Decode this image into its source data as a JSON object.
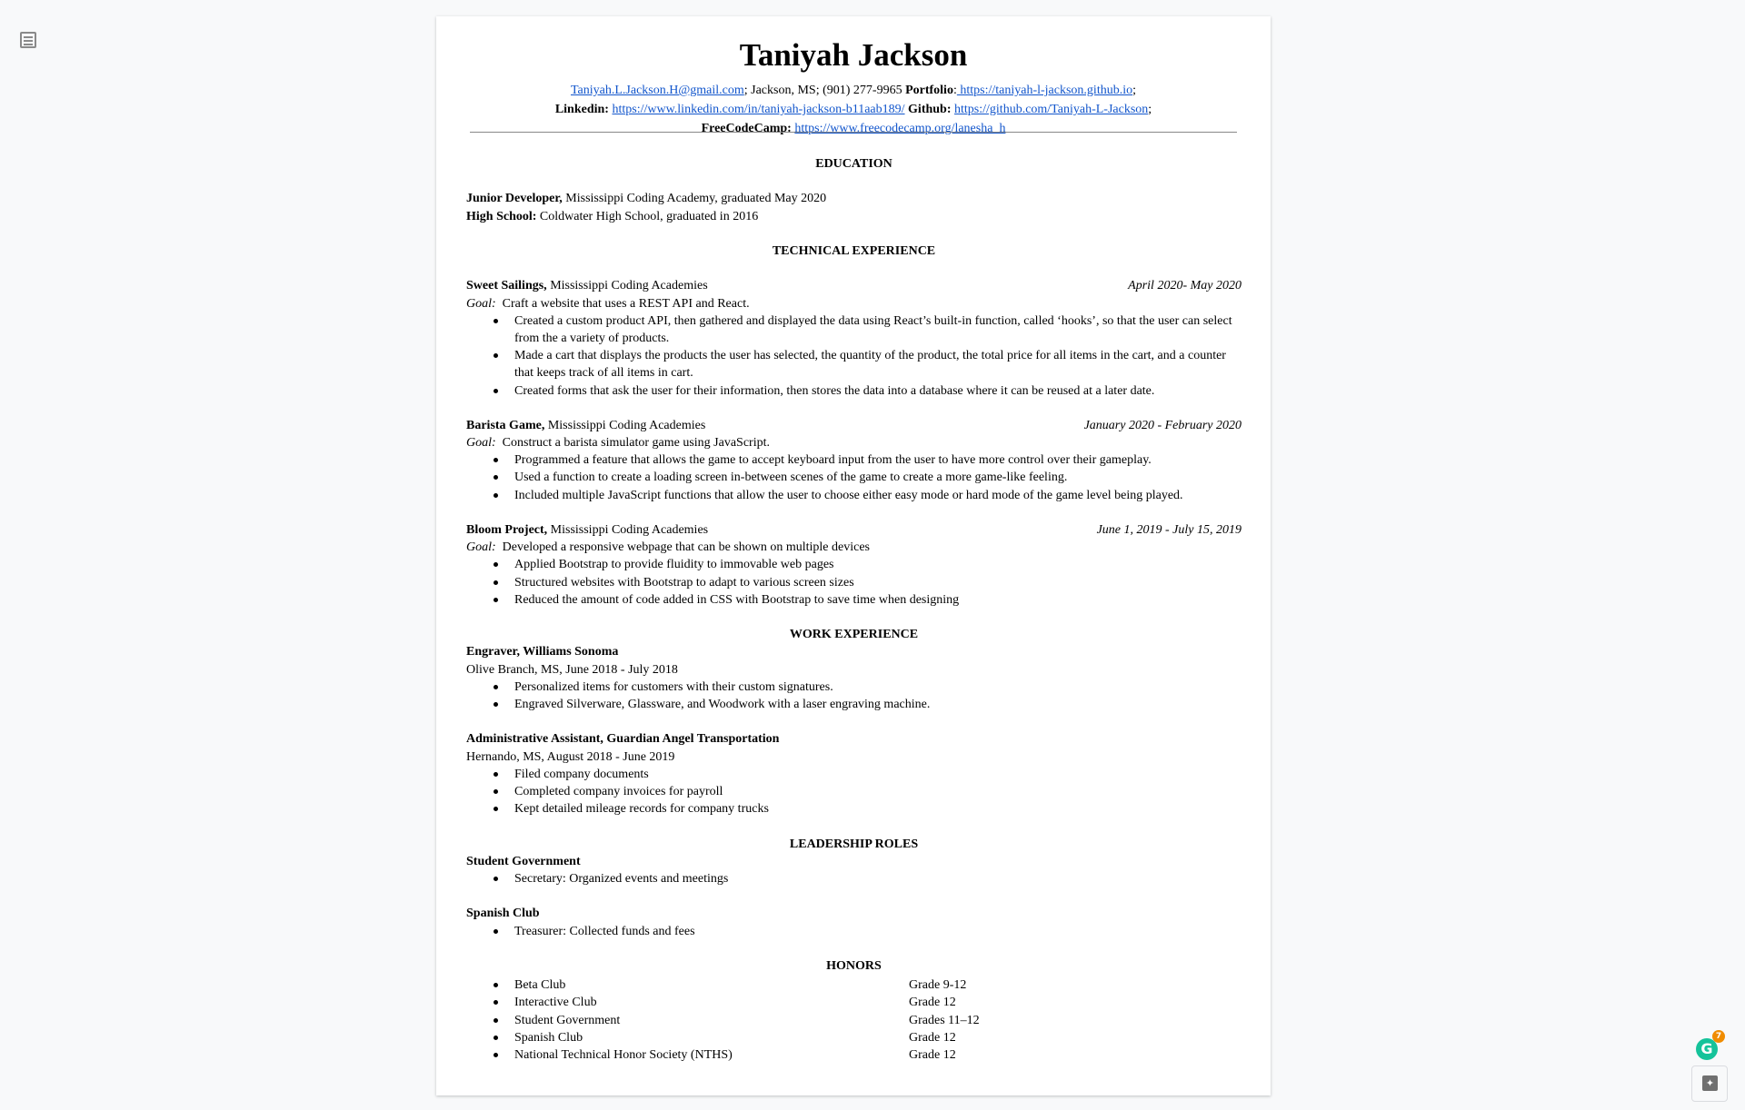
{
  "header": {
    "name": "Taniyah Jackson",
    "email": "Taniyah.L.Jackson.H@gmail.com",
    "location_phone": "; Jackson, MS; (901) 277-9965 ",
    "portfolio_label": "Portfolio",
    "portfolio_url": " https://taniyah-l-jackson.github.io",
    "linkedin_label": "Linkedin:",
    "linkedin_url": "https://www.linkedin.com/in/taniyah-jackson-b11aab189/",
    "github_label": "Github:",
    "github_url": "https://github.com/Taniyah-L-Jackson",
    "fcc_label": "FreeCodeCamp:",
    "fcc_url": "https://www.freecodecamp.org/lanesha_h"
  },
  "education": {
    "heading": "EDUCATION",
    "items": [
      {
        "title": "Junior Developer,",
        "text": " Mississippi Coding Academy, graduated May 2020"
      },
      {
        "title": "High School:",
        "text": " Coldwater High School, graduated in 2016"
      }
    ]
  },
  "technical": {
    "heading": "TECHNICAL EXPERIENCE",
    "goal_label": "Goal:",
    "projects": [
      {
        "title": "Sweet Sailings,",
        "org": "  Mississippi Coding Academies",
        "dates": "April 2020- May 2020",
        "goal": "Craft a website that uses a REST API and React.",
        "bullets": [
          "Created a custom product API, then gathered and displayed the data using React’s built-in function, called ‘hooks’, so that the user can select from the a variety of products.",
          "Made a cart that displays the products the user has selected, the quantity of the product, the total price for all items in the cart, and a counter that keeps track of all items in cart.",
          "Created forms that ask the user for their information, then stores the data into a database where it can be reused at a later date."
        ]
      },
      {
        "title": "Barista Game,",
        "org": "  Mississippi Coding Academies",
        "dates": "January 2020 - February 2020",
        "goal": "Construct a barista simulator game using JavaScript.",
        "bullets": [
          "Programmed a feature that allows the game to accept keyboard input from the user to have more control over their gameplay.",
          "Used a function to create a loading screen in-between scenes of the game to create a more game-like feeling.",
          "Included multiple JavaScript functions that allow the user to choose either easy mode or hard mode of the game level being played."
        ]
      },
      {
        "title": "Bloom Project,",
        "org": " Mississippi Coding Academies",
        "dates": "June 1, 2019 - July 15, 2019",
        "goal": "Developed a responsive webpage that can be shown on multiple devices",
        "bullets": [
          "Applied Bootstrap to provide fluidity to immovable web pages",
          "Structured websites with Bootstrap to adapt to various screen sizes",
          "Reduced the amount of code added in CSS with Bootstrap to save time when designing"
        ]
      }
    ]
  },
  "work": {
    "heading": "WORK EXPERIENCE",
    "jobs": [
      {
        "title": "Engraver, Williams Sonoma",
        "meta": "Olive Branch, MS, June 2018 - July 2018",
        "bullets": [
          "Personalized items for customers with their custom signatures.",
          "Engraved Silverware, Glassware, and Woodwork with a laser engraving machine."
        ]
      },
      {
        "title": "Administrative Assistant, Guardian Angel Transportation",
        "meta": "Hernando, MS, August 2018 - June  2019",
        "bullets": [
          "Filed company documents",
          "Completed company invoices for payroll",
          "Kept detailed mileage records for company trucks"
        ]
      }
    ]
  },
  "leadership": {
    "heading": "LEADERSHIP ROLES",
    "roles": [
      {
        "title": "Student Government",
        "bullets": [
          "Secretary: Organized events and meetings"
        ]
      },
      {
        "title": "Spanish Club",
        "bullets": [
          " Treasurer: Collected funds and fees"
        ]
      }
    ]
  },
  "honors": {
    "heading": "HONORS",
    "items": [
      {
        "name": "Beta Club",
        "grade": "Grade 9-12"
      },
      {
        "name": "Interactive Club",
        "grade": "Grade 12"
      },
      {
        "name": "Student Government",
        "grade": "Grades 11–12"
      },
      {
        "name": "Spanish Club",
        "grade": "Grade 12"
      },
      {
        "name": "National Technical Honor Society (NTHS)",
        "grade": "Grade 12"
      }
    ]
  },
  "widgets": {
    "grammarly_count": "7",
    "grammarly_letter": "G",
    "explore_icon": "sparkle-icon",
    "outline_icon": "document-outline-icon",
    "link_color": "#1155cc",
    "grammarly_color": "#15c39a"
  }
}
